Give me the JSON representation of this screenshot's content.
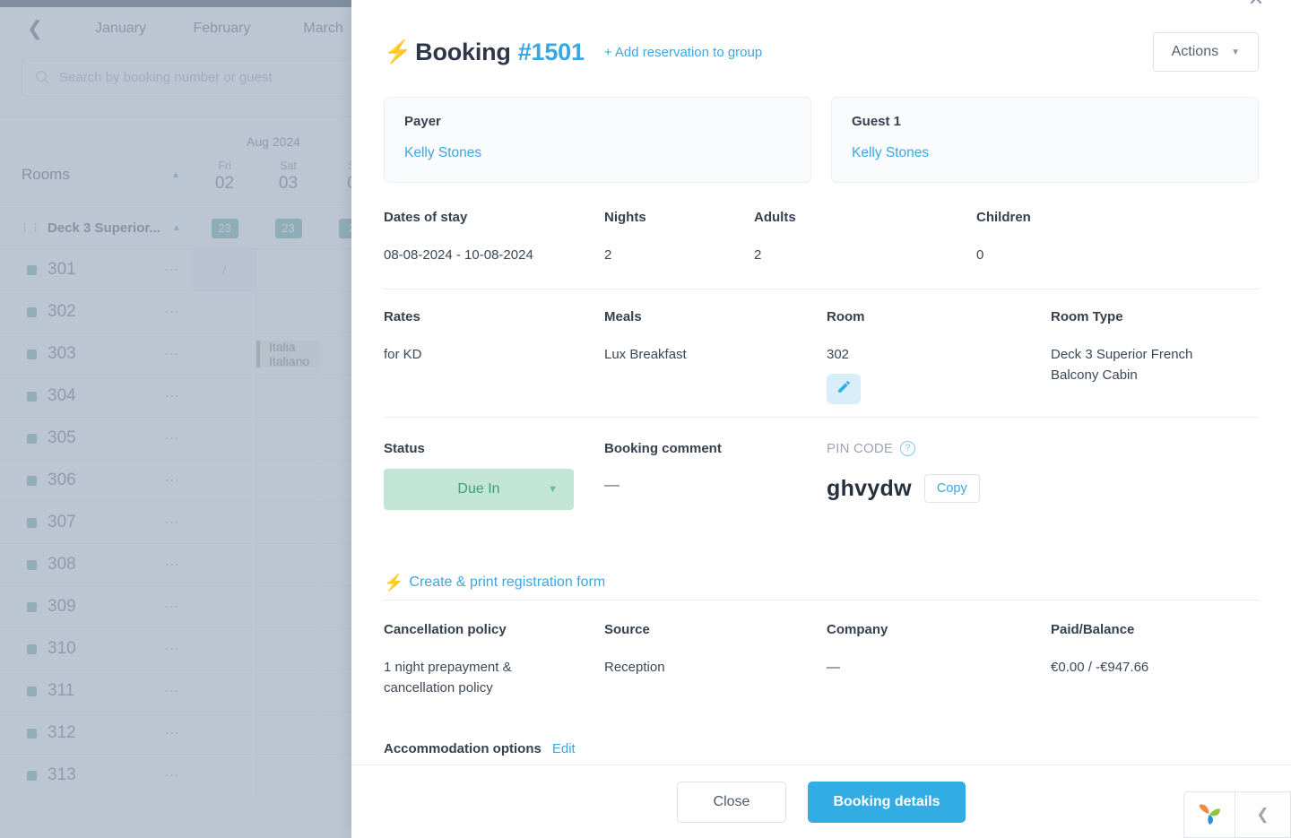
{
  "background": {
    "nav": {
      "back_icon": "chevron-left-icon",
      "months": [
        "January",
        "February",
        "March"
      ]
    },
    "search": {
      "placeholder": "Search by booking number or guest",
      "icon": "search-icon"
    },
    "calendar": {
      "month_label": "Aug 2024",
      "rooms_header": "Rooms",
      "days": [
        {
          "name": "Fri",
          "num": "02"
        },
        {
          "name": "Sat",
          "num": "03"
        },
        {
          "name": "S",
          "num": "0"
        }
      ],
      "group": {
        "name": "Deck 3 Superior...",
        "badges": [
          "23",
          "23",
          "2"
        ]
      },
      "rooms": [
        "301",
        "302",
        "303",
        "304",
        "305",
        "306",
        "307",
        "308",
        "309",
        "310",
        "311",
        "312",
        "313"
      ],
      "reservation_label": "Italia Italiano",
      "cell_mark": "/"
    }
  },
  "modal": {
    "close_icon": "close-icon",
    "header": {
      "bolt_icon": "lightning-bolt-icon",
      "title": "Booking",
      "number": "#1501",
      "add_reservation": "+ Add reservation to group",
      "actions_label": "Actions",
      "actions_caret": "chevron-down-icon"
    },
    "payer": {
      "label": "Payer",
      "value": "Kelly Stones"
    },
    "guest": {
      "label": "Guest 1",
      "value": "Kelly Stones"
    },
    "stay": {
      "dates_label": "Dates of stay",
      "dates_value": "08-08-2024 - 10-08-2024",
      "nights_label": "Nights",
      "nights_value": "2",
      "adults_label": "Adults",
      "adults_value": "2",
      "children_label": "Children",
      "children_value": "0"
    },
    "room_info": {
      "rates_label": "Rates",
      "rates_value": "for KD",
      "meals_label": "Meals",
      "meals_value": "Lux Breakfast",
      "room_label": "Room",
      "room_value": "302",
      "room_edit_icon": "pencil-icon",
      "room_type_label": "Room Type",
      "room_type_value": "Deck 3 Superior French Balcony Cabin"
    },
    "status_row": {
      "status_label": "Status",
      "status_value": "Due In",
      "status_caret": "chevron-down-icon",
      "status_bg": "#c3e5d5",
      "status_fg": "#3f9c75",
      "comment_label": "Booking comment",
      "comment_value": "—",
      "pin_label": "PIN CODE",
      "pin_help_icon": "help-circle-icon",
      "pin_value": "ghvydw",
      "copy_label": "Copy"
    },
    "registration_link": {
      "bolt_icon": "lightning-bolt-icon",
      "label": "Create & print registration form"
    },
    "policy_row": {
      "cancellation_label": "Cancellation policy",
      "cancellation_value": "1 night prepayment & cancellation policy",
      "source_label": "Source",
      "source_value": "Reception",
      "company_label": "Company",
      "company_value": "—",
      "paid_label": "Paid/Balance",
      "paid_value": "€0.00 / -€947.66"
    },
    "accommodation": {
      "label": "Accommodation options",
      "edit_label": "Edit"
    },
    "footer": {
      "close_label": "Close",
      "details_label": "Booking details",
      "accent": "#31ade3"
    }
  },
  "chat_widget": {
    "logo_icon": "leaf-logo-icon",
    "collapse_icon": "chevron-left-icon"
  }
}
